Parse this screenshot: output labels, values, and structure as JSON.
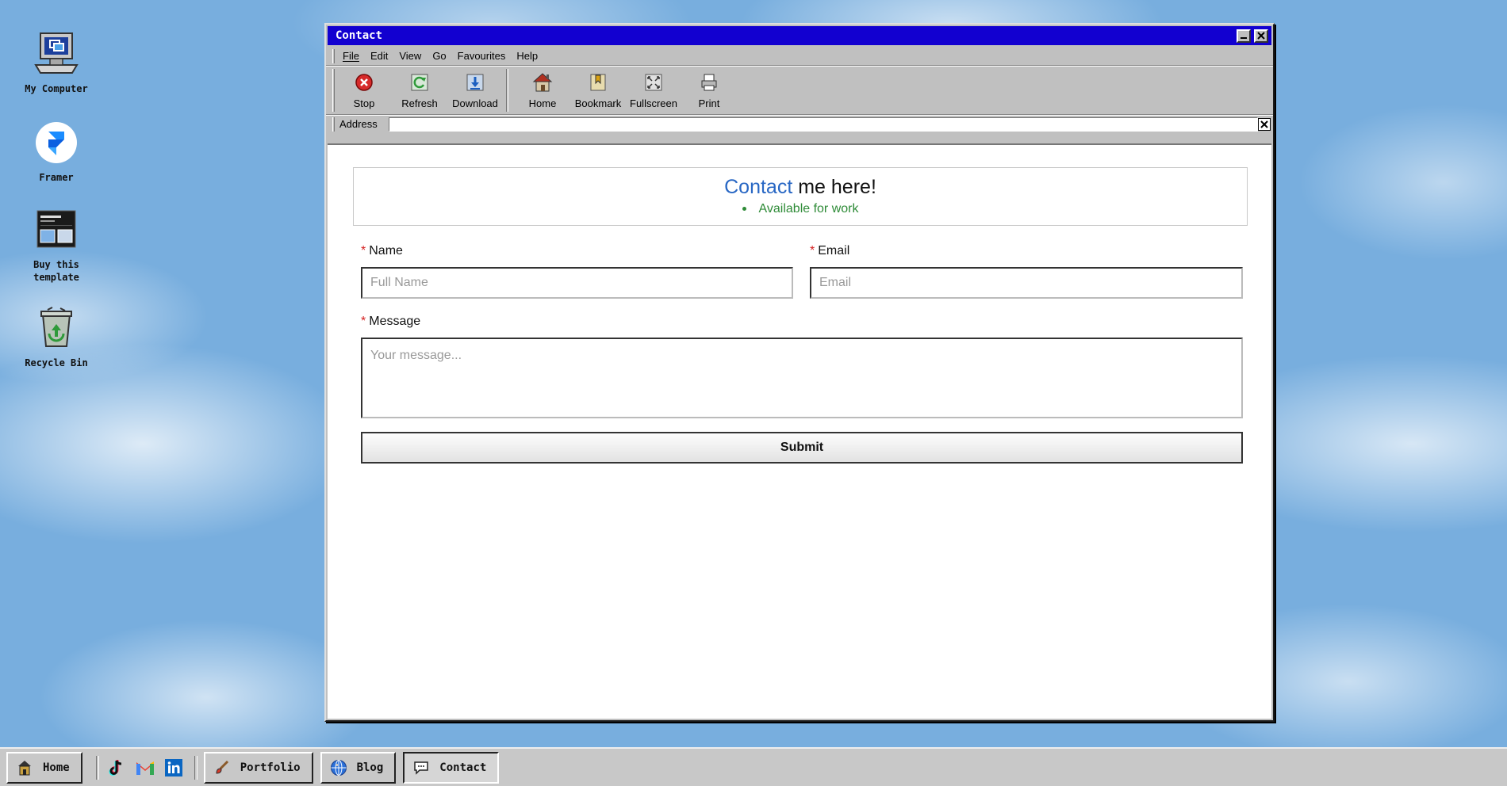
{
  "desktop": {
    "icons": [
      {
        "label": "My Computer",
        "icon": "computer-icon"
      },
      {
        "label": "Framer",
        "icon": "framer-icon"
      },
      {
        "label": "Buy this template",
        "icon": "template-icon"
      },
      {
        "label": "Recycle Bin",
        "icon": "recycle-bin-icon"
      }
    ]
  },
  "window": {
    "title": "Contact",
    "menu": [
      "File",
      "Edit",
      "View",
      "Go",
      "Favourites",
      "Help"
    ],
    "toolbar": [
      {
        "label": "Stop",
        "icon": "stop-icon"
      },
      {
        "label": "Refresh",
        "icon": "refresh-icon"
      },
      {
        "label": "Download",
        "icon": "download-icon"
      },
      {
        "label": "Home",
        "icon": "home-icon"
      },
      {
        "label": "Bookmark",
        "icon": "bookmark-icon"
      },
      {
        "label": "Fullscreen",
        "icon": "fullscreen-icon"
      },
      {
        "label": "Print",
        "icon": "print-icon"
      }
    ],
    "address": {
      "label": "Address",
      "value": ""
    }
  },
  "contact": {
    "title_accent": "Contact",
    "title_rest": " me here!",
    "status": "Available for work",
    "required_mark": "*",
    "name_label": "Name",
    "name_placeholder": "Full Name",
    "email_label": "Email",
    "email_placeholder": "Email",
    "message_label": "Message",
    "message_placeholder": "Your message...",
    "submit_label": "Submit"
  },
  "taskbar": {
    "home": "Home",
    "social": [
      "tiktok-icon",
      "gmail-icon",
      "linkedin-icon"
    ],
    "tasks": [
      {
        "label": "Portfolio",
        "icon": "paintbrush-icon"
      },
      {
        "label": "Blog",
        "icon": "globe-icon"
      },
      {
        "label": "Contact",
        "icon": "speech-bubble-icon",
        "active": true
      }
    ]
  },
  "colors": {
    "titlebar": "#1200d0",
    "accent": "#2867c4",
    "status": "#2e8b37",
    "required": "#d42020"
  }
}
